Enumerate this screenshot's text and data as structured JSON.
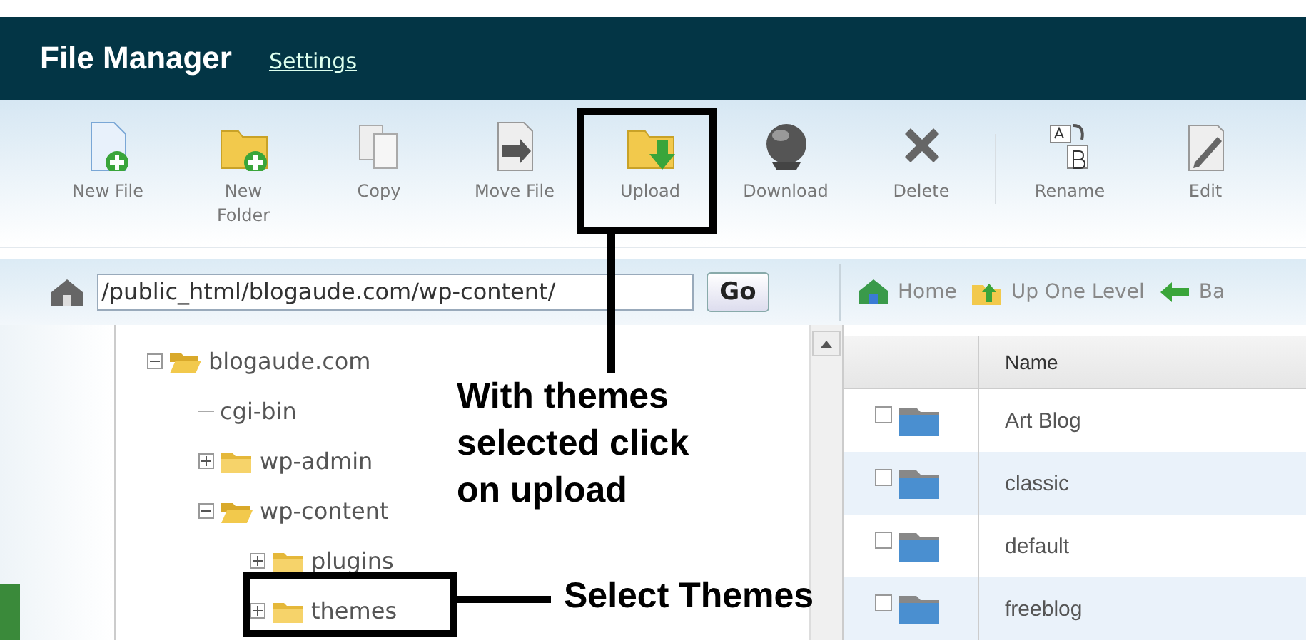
{
  "header": {
    "title": "File Manager",
    "settings_link": "Settings"
  },
  "toolbar": [
    {
      "label": "New File"
    },
    {
      "label": "New Folder"
    },
    {
      "label": "Copy"
    },
    {
      "label": "Move File"
    },
    {
      "label": "Upload"
    },
    {
      "label": "Download"
    },
    {
      "label": "Delete"
    },
    {
      "label": "Rename"
    },
    {
      "label": "Edit"
    }
  ],
  "path_bar": {
    "path": "/public_html/blogaude.com/wp-content/",
    "go_button": "Go",
    "nav": [
      {
        "label": "Home"
      },
      {
        "label": "Up One Level"
      },
      {
        "label": "Ba"
      }
    ]
  },
  "tree": [
    {
      "name": "blogaude.com",
      "expanded": true,
      "children": [
        {
          "name": "cgi-bin"
        },
        {
          "name": "wp-admin",
          "expanded": false
        },
        {
          "name": "wp-content",
          "expanded": true,
          "children": [
            {
              "name": "plugins",
              "expanded": false
            },
            {
              "name": "themes",
              "expanded": false
            }
          ]
        }
      ]
    }
  ],
  "file_list": {
    "columns": [
      "Name"
    ],
    "rows": [
      {
        "name": "Art Blog",
        "checked": false
      },
      {
        "name": "classic",
        "checked": false
      },
      {
        "name": "default",
        "checked": false
      },
      {
        "name": "freeblog",
        "checked": false
      }
    ]
  },
  "annotations": [
    {
      "kind": "callout",
      "lines": [
        "With themes",
        "selected click",
        "on upload"
      ]
    },
    {
      "kind": "label",
      "text": "Select Themes"
    }
  ]
}
